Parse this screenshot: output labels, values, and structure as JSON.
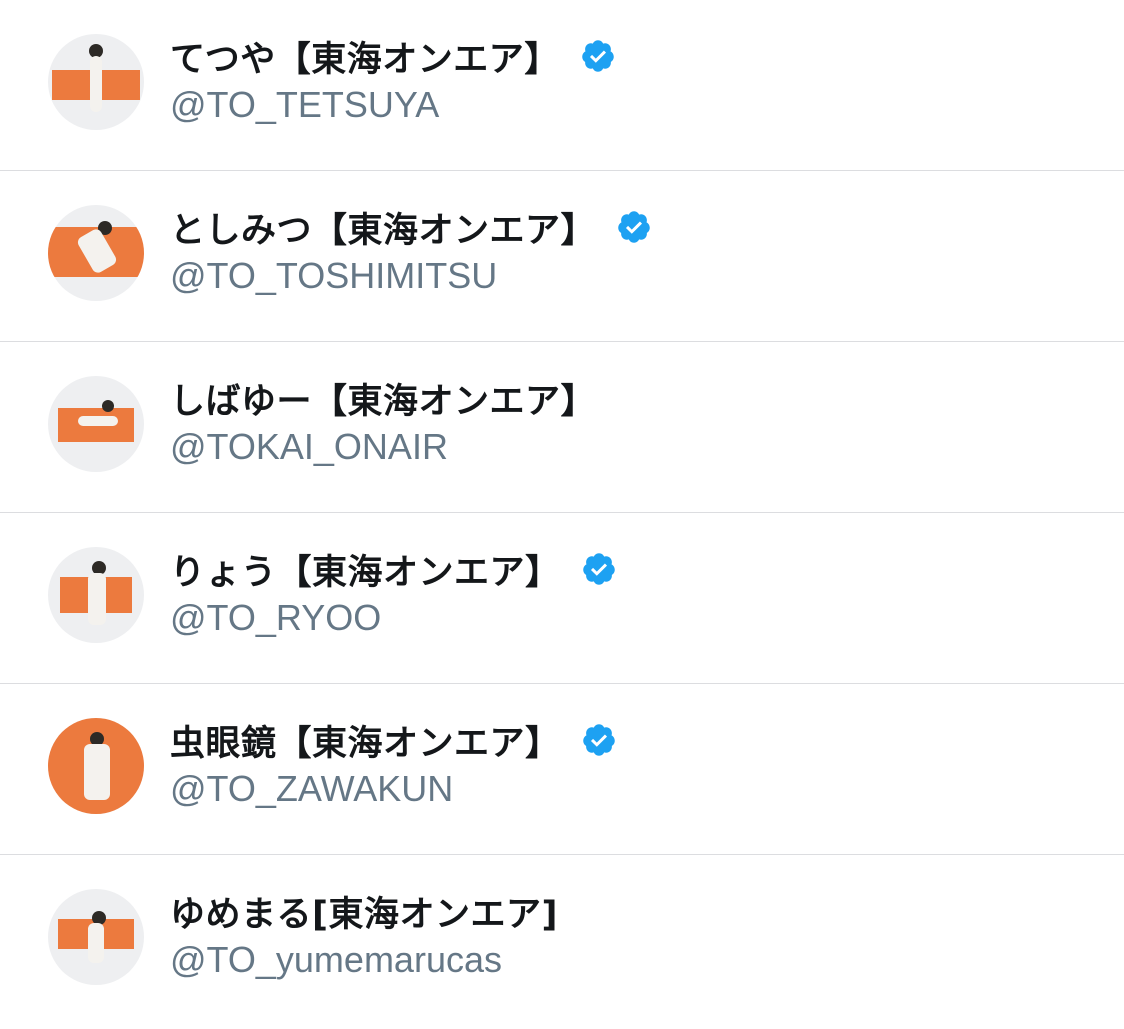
{
  "accounts": [
    {
      "display_name": "てつや【東海オンエア】",
      "handle": "@TO_TETSUYA",
      "verified": true
    },
    {
      "display_name": "としみつ【東海オンエア】",
      "handle": "@TO_TOSHIMITSU",
      "verified": true
    },
    {
      "display_name": "しばゆー【東海オンエア】",
      "handle": "@TOKAI_ONAIR",
      "verified": false
    },
    {
      "display_name": "りょう【東海オンエア】",
      "handle": "@TO_RYOO",
      "verified": true
    },
    {
      "display_name": "虫眼鏡【東海オンエア】",
      "handle": "@TO_ZAWAKUN",
      "verified": true
    },
    {
      "display_name": "ゆめまる[東海オンエア]",
      "handle": "@TO_yumemarucas",
      "verified": false
    }
  ],
  "colors": {
    "verified_blue": "#1da1f2",
    "avatar_orange": "#ec7a3e",
    "handle_gray": "#657786",
    "name_black": "#14171a",
    "divider": "#dcdde0"
  },
  "icons": {
    "verified": "verified-badge-icon",
    "avatar": "avatar-image"
  }
}
